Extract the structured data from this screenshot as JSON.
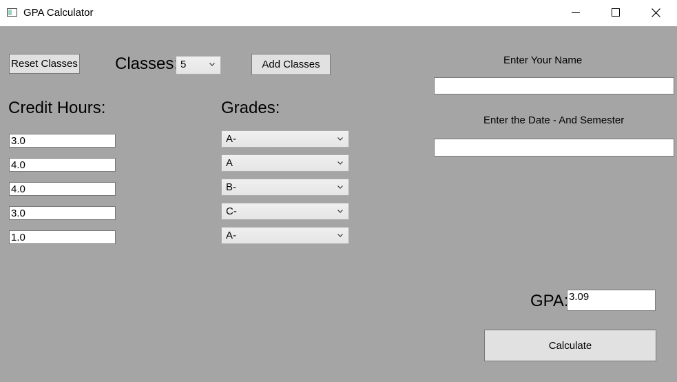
{
  "window": {
    "title": "GPA Calculator"
  },
  "toolbar": {
    "reset_label": "Reset Classes",
    "classes_label": "Classes:",
    "classes_value": "5",
    "add_label": "Add Classes"
  },
  "columns": {
    "credit_hours_label": "Credit Hours:",
    "grades_label": "Grades:"
  },
  "credit_hours": [
    "3.0",
    "4.0",
    "4.0",
    "3.0",
    "1.0"
  ],
  "grades": [
    "A-",
    "A",
    "B-",
    "C-",
    "A-"
  ],
  "form": {
    "name_label": "Enter Your Name",
    "name_value": "",
    "date_label": "Enter the Date - And Semester",
    "date_value": ""
  },
  "result": {
    "gpa_label": "GPA:",
    "gpa_value": "3.09",
    "calculate_label": "Calculate"
  }
}
